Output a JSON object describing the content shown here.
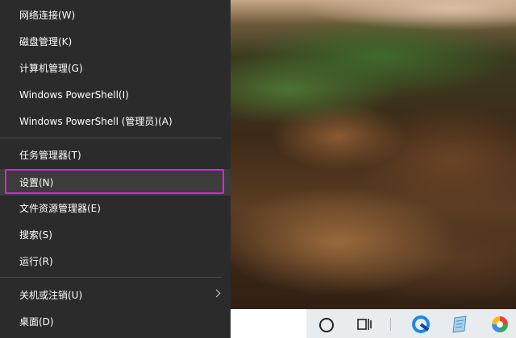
{
  "menu": {
    "items": [
      {
        "label": "网络连接(W)"
      },
      {
        "label": "磁盘管理(K)"
      },
      {
        "label": "计算机管理(G)"
      },
      {
        "label": "Windows PowerShell(I)"
      },
      {
        "label": "Windows PowerShell (管理员)(A)"
      },
      {
        "label": "任务管理器(T)"
      },
      {
        "label": "设置(N)"
      },
      {
        "label": "文件资源管理器(E)"
      },
      {
        "label": "搜索(S)"
      },
      {
        "label": "运行(R)"
      },
      {
        "label": "关机或注销(U)"
      },
      {
        "label": "桌面(D)"
      }
    ],
    "highlighted_item": "设置(N)",
    "highlight_color": "#e020e0"
  },
  "taskbar": {
    "icons": [
      "cortana-circle-icon",
      "task-view-icon",
      "browser-app-icon",
      "notepad-app-icon",
      "colorful-app-icon"
    ]
  }
}
